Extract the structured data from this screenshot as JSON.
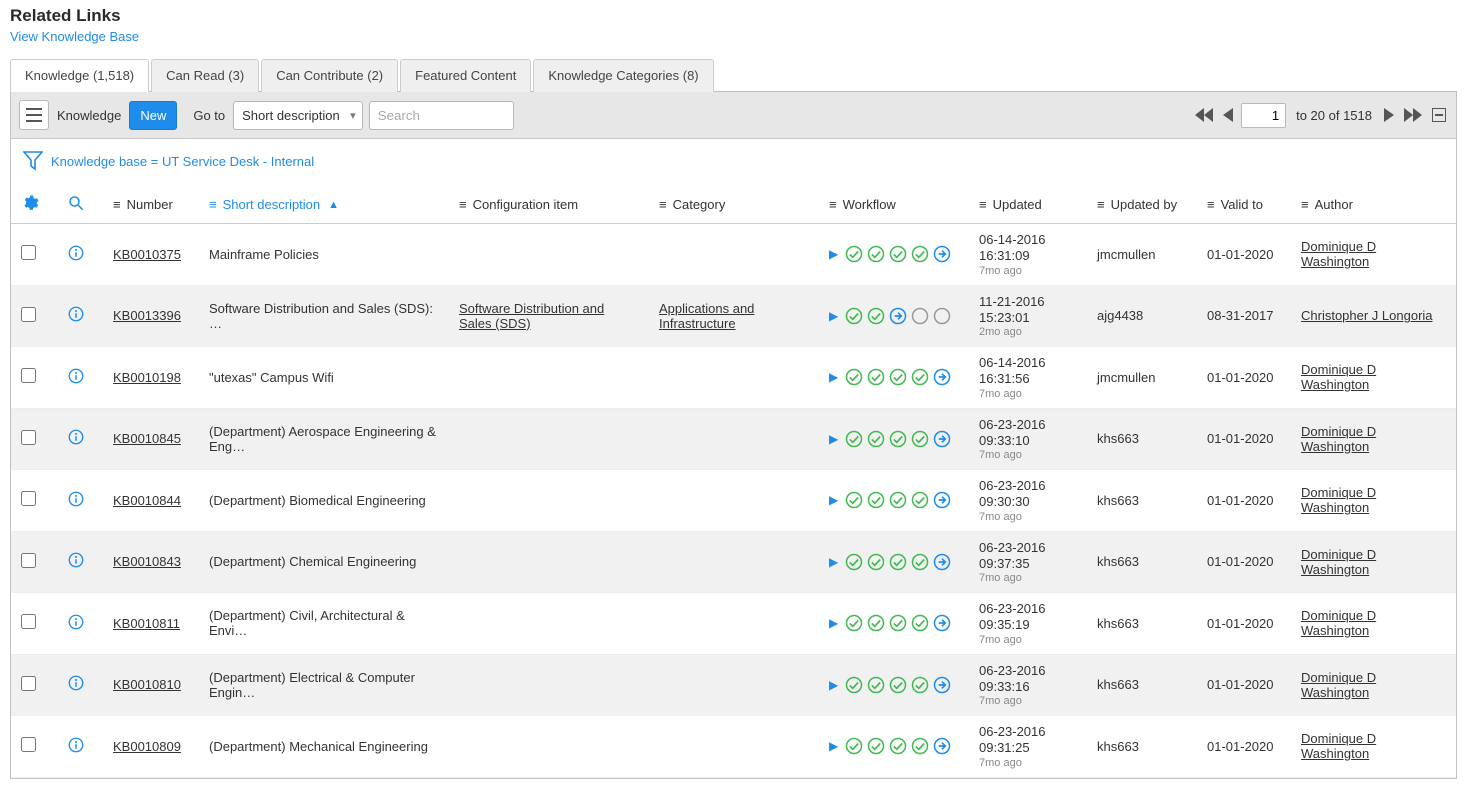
{
  "header": {
    "title": "Related Links",
    "link": "View Knowledge Base"
  },
  "tabs": [
    {
      "label": "Knowledge (1,518)",
      "active": true
    },
    {
      "label": "Can Read (3)",
      "active": false
    },
    {
      "label": "Can Contribute (2)",
      "active": false
    },
    {
      "label": "Featured Content",
      "active": false
    },
    {
      "label": "Knowledge Categories (8)",
      "active": false
    }
  ],
  "toolbar": {
    "list_title": "Knowledge",
    "new_label": "New",
    "goto_label": "Go to",
    "goto_select": "Short description",
    "search_placeholder": "Search"
  },
  "pager": {
    "current": "1",
    "range": "to 20 of 1518"
  },
  "filter": {
    "text": "Knowledge base = UT Service Desk - Internal"
  },
  "columns": {
    "number": "Number",
    "short_desc": "Short description",
    "config_item": "Configuration item",
    "category": "Category",
    "workflow": "Workflow",
    "updated": "Updated",
    "updated_by": "Updated by",
    "valid_to": "Valid to",
    "author": "Author"
  },
  "rows": [
    {
      "number": "KB0010375",
      "short_desc": "Mainframe Policies",
      "config_item": "",
      "category": "",
      "workflow": "full",
      "updated_date": "06-14-2016",
      "updated_time": "16:31:09",
      "ago": "7mo ago",
      "updated_by": "jmcmullen",
      "valid_to": "01-01-2020",
      "author": "Dominique D Washington"
    },
    {
      "number": "KB0013396",
      "short_desc": "Software Distribution and Sales (SDS): …",
      "config_item": "Software Distribution and Sales (SDS)",
      "category": "Applications and Infrastructure",
      "workflow": "partial",
      "updated_date": "11-21-2016",
      "updated_time": "15:23:01",
      "ago": "2mo ago",
      "updated_by": "ajg4438",
      "valid_to": "08-31-2017",
      "author": "Christopher J Longoria"
    },
    {
      "number": "KB0010198",
      "short_desc": "\"utexas\" Campus Wifi",
      "config_item": "",
      "category": "",
      "workflow": "full",
      "updated_date": "06-14-2016",
      "updated_time": "16:31:56",
      "ago": "7mo ago",
      "updated_by": "jmcmullen",
      "valid_to": "01-01-2020",
      "author": "Dominique D Washington"
    },
    {
      "number": "KB0010845",
      "short_desc": "(Department) Aerospace Engineering & Eng…",
      "config_item": "",
      "category": "",
      "workflow": "full",
      "updated_date": "06-23-2016",
      "updated_time": "09:33:10",
      "ago": "7mo ago",
      "updated_by": "khs663",
      "valid_to": "01-01-2020",
      "author": "Dominique D Washington"
    },
    {
      "number": "KB0010844",
      "short_desc": "(Department) Biomedical Engineering",
      "config_item": "",
      "category": "",
      "workflow": "full",
      "updated_date": "06-23-2016",
      "updated_time": "09:30:30",
      "ago": "7mo ago",
      "updated_by": "khs663",
      "valid_to": "01-01-2020",
      "author": "Dominique D Washington"
    },
    {
      "number": "KB0010843",
      "short_desc": "(Department) Chemical Engineering",
      "config_item": "",
      "category": "",
      "workflow": "full",
      "updated_date": "06-23-2016",
      "updated_time": "09:37:35",
      "ago": "7mo ago",
      "updated_by": "khs663",
      "valid_to": "01-01-2020",
      "author": "Dominique D Washington"
    },
    {
      "number": "KB0010811",
      "short_desc": "(Department) Civil, Architectural & Envi…",
      "config_item": "",
      "category": "",
      "workflow": "full",
      "updated_date": "06-23-2016",
      "updated_time": "09:35:19",
      "ago": "7mo ago",
      "updated_by": "khs663",
      "valid_to": "01-01-2020",
      "author": "Dominique D Washington"
    },
    {
      "number": "KB0010810",
      "short_desc": "(Department) Electrical & Computer Engin…",
      "config_item": "",
      "category": "",
      "workflow": "full",
      "updated_date": "06-23-2016",
      "updated_time": "09:33:16",
      "ago": "7mo ago",
      "updated_by": "khs663",
      "valid_to": "01-01-2020",
      "author": "Dominique D Washington"
    },
    {
      "number": "KB0010809",
      "short_desc": "(Department) Mechanical Engineering",
      "config_item": "",
      "category": "",
      "workflow": "full",
      "updated_date": "06-23-2016",
      "updated_time": "09:31:25",
      "ago": "7mo ago",
      "updated_by": "khs663",
      "valid_to": "01-01-2020",
      "author": "Dominique D Washington"
    }
  ]
}
